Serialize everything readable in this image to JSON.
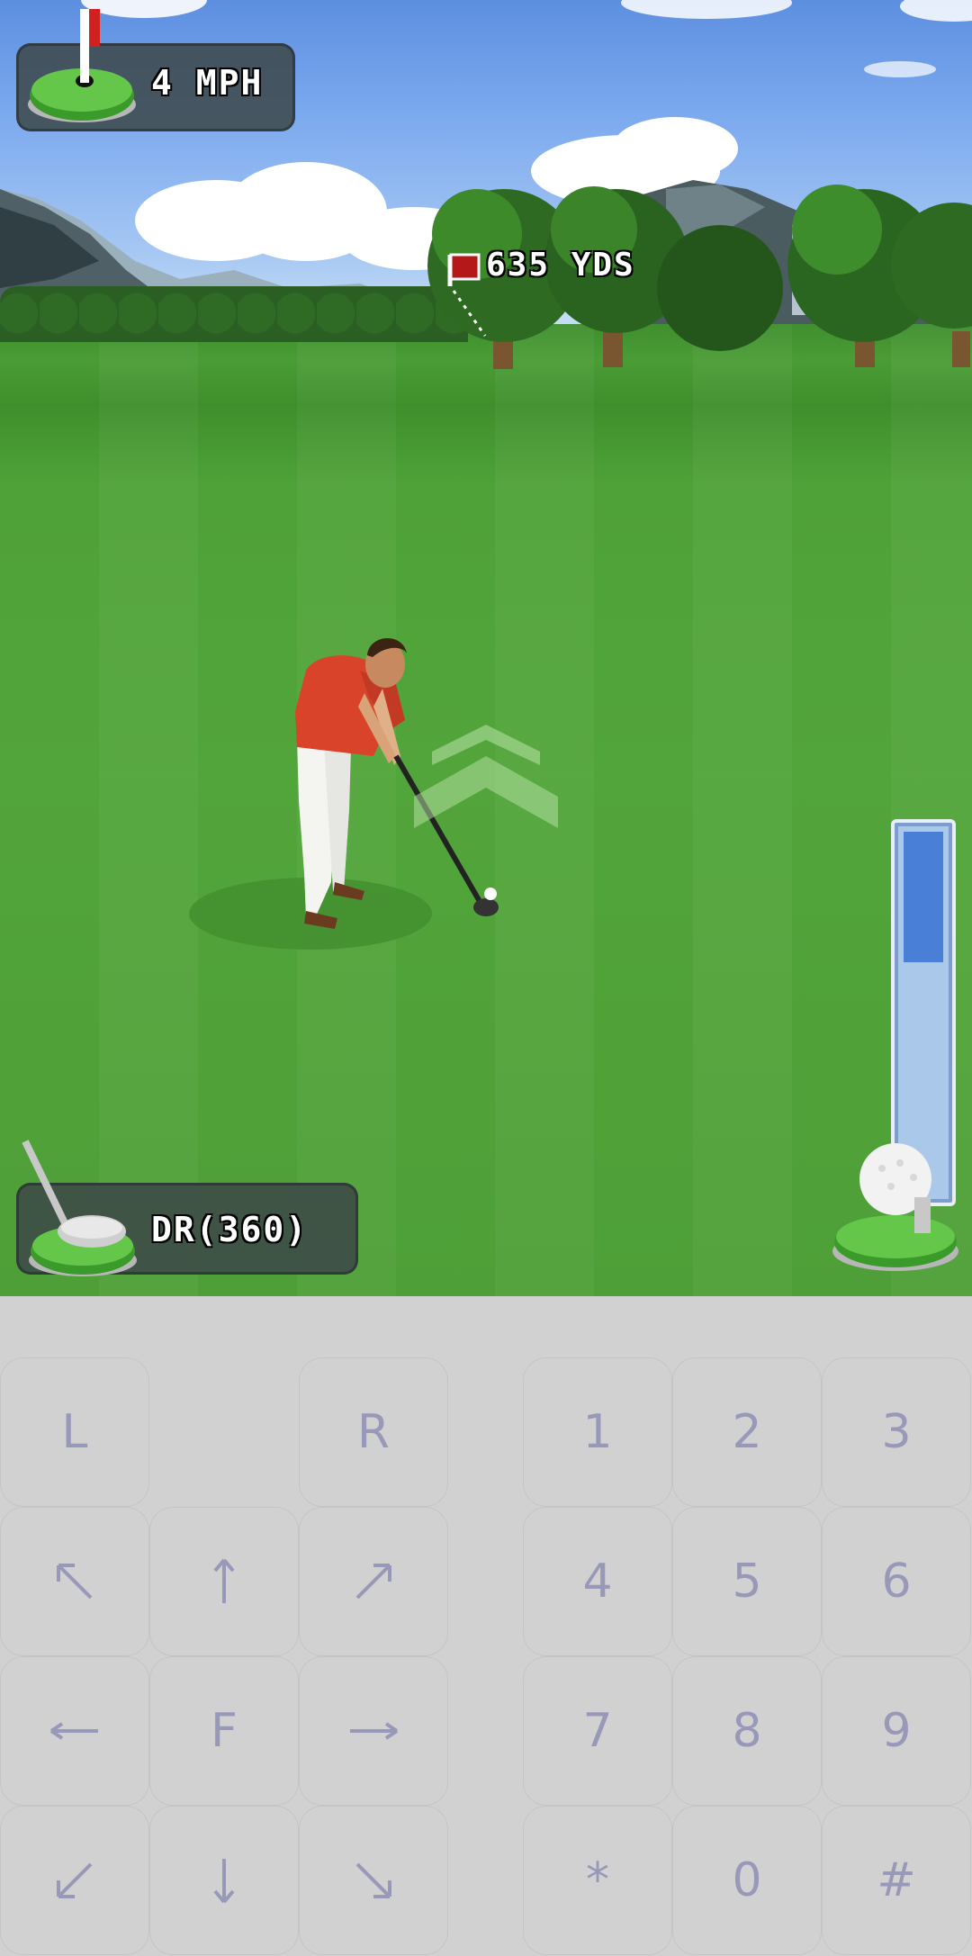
{
  "hud": {
    "wind_text": "4 MPH",
    "distance_text": "635 YDS",
    "club_text": "DR(360)",
    "power_meter_level": 0.36
  },
  "keypad": {
    "keys": {
      "l": "L",
      "r": "R",
      "one": "1",
      "two": "2",
      "three": "3",
      "four": "4",
      "five": "5",
      "six": "6",
      "seven": "7",
      "eight": "8",
      "nine": "9",
      "f": "F",
      "star": "*",
      "zero": "0",
      "hash": "#"
    },
    "arrow_icons": [
      "arrow-up-left-icon",
      "arrow-up-icon",
      "arrow-up-right-icon",
      "arrow-left-icon",
      "arrow-right-icon",
      "arrow-down-left-icon",
      "arrow-down-icon",
      "arrow-down-right-icon"
    ]
  },
  "colors": {
    "grass": "#52a53a",
    "shirt": "#d9432a",
    "keypad_bg": "#d1d1d1",
    "key_text": "#9898b8",
    "meter_fill": "#4a7fd8"
  }
}
